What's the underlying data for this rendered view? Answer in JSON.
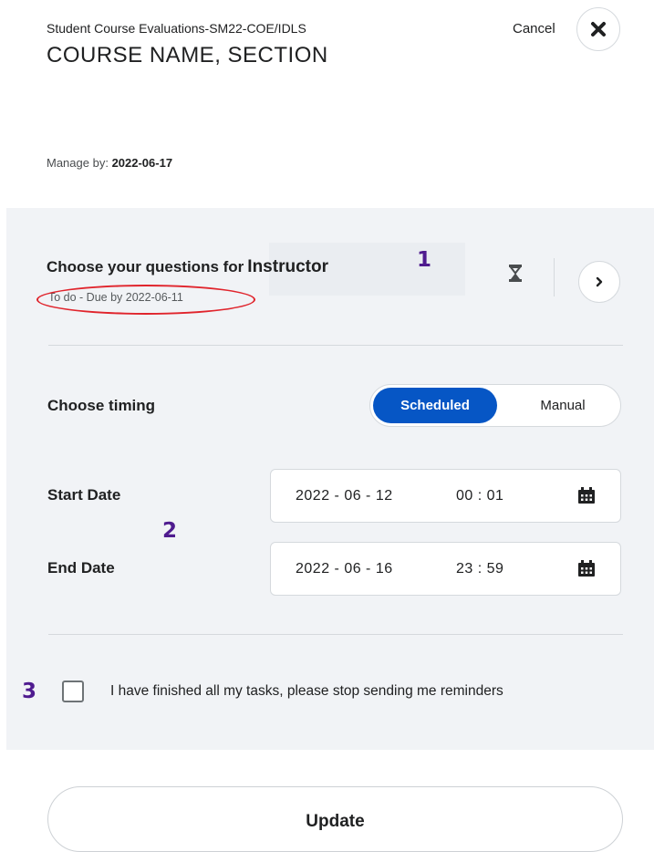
{
  "header": {
    "org_label": "Student Course Evaluations-SM22-COE/IDLS",
    "course_title": "COURSE NAME, SECTION",
    "cancel_label": "Cancel",
    "close_icon": "close-x-icon"
  },
  "manage": {
    "label": "Manage by:",
    "date": "2022-06-17"
  },
  "task": {
    "title_prefix": "Choose your questions for",
    "role": "Instructor",
    "status": "To do - Due by 2022-06-11",
    "status_icon": "hourglass-icon",
    "next_icon": "chevron-right-icon"
  },
  "annotations": {
    "one": "1",
    "two": "2",
    "three": "3",
    "color": "#4f1b8f",
    "ellipse_color": "#e0242c"
  },
  "timing": {
    "label": "Choose timing",
    "options": [
      "Scheduled",
      "Manual"
    ],
    "selected": "Scheduled",
    "accent": "#0656c5"
  },
  "dates": {
    "start_label": "Start Date",
    "start_date": "2022 - 06 - 12",
    "start_time": "00 : 01",
    "end_label": "End Date",
    "end_date": "2022 - 06 - 16",
    "end_time": "23 : 59",
    "calendar_icon": "calendar-icon"
  },
  "reminder": {
    "checked": false,
    "label": "I have finished all my tasks, please stop sending me reminders"
  },
  "footer": {
    "update_label": "Update"
  }
}
